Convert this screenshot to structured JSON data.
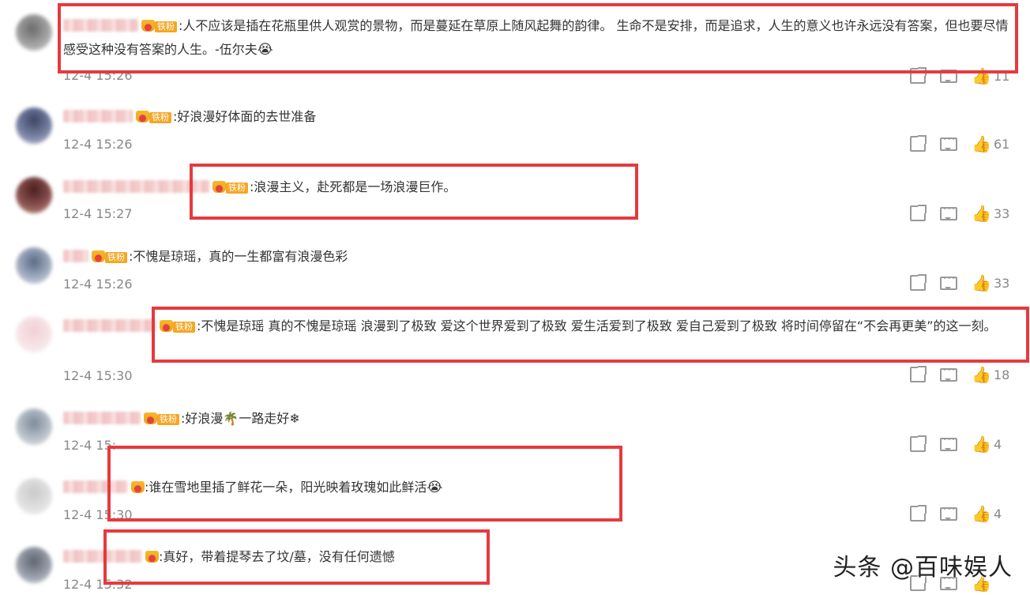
{
  "comments": [
    {
      "text": "人不应该是插在花瓶里供人观赏的景物，而是蔓延在草原上随风起舞的韵律。 生命不是安排，而是追求，人生的意义也许永远没有答案，但也要尽情感受这种没有答案的人生。-伍尔夫",
      "emoji": "😭",
      "badge": "铁粉",
      "time": "12-4 15:26",
      "likes": "11"
    },
    {
      "text": "好浪漫好体面的去世准备",
      "badge": "铁粉",
      "time": "12-4 15:26",
      "likes": "61"
    },
    {
      "text": "浪漫主义，赴死都是一场浪漫巨作。",
      "badge": "铁粉",
      "time": "12-4 15:27",
      "likes": "33"
    },
    {
      "text": "不愧是琼瑶，真的一生都富有浪漫色彩",
      "badge": "铁粉",
      "time": "12-4 15:26",
      "likes": "33"
    },
    {
      "text": "不愧是琼瑶 真的不愧是琼瑶 浪漫到了极致 爱这个世界爱到了极致 爱生活爱到了极致 爱自己爱到了极致 将时间停留在“不会再更美”的这一刻。",
      "badge": "铁粉",
      "time": "12-4 15:30",
      "likes": "18"
    },
    {
      "text": "好浪漫🌴一路走好❄",
      "badge": "铁粉",
      "time": "12-4 15:",
      "likes": "4"
    },
    {
      "text": "谁在雪地里插了鲜花一朵，阳光映着玫瑰如此鲜活",
      "emoji": "😭",
      "badge": "",
      "time": "12-4 15:30",
      "likes": "4"
    },
    {
      "text": "真好，带着提琴去了坟/墓，没有任何遗憾",
      "badge": "",
      "time": "12-4 15:32",
      "likes": ""
    }
  ],
  "watermark": "头条 @百味娱人",
  "colors": {
    "highlight": "#e63a3e",
    "fan_badge": "#f5a623",
    "time": "#888888",
    "icon": "#999999"
  },
  "icons": [
    "share-icon",
    "comment-icon",
    "like-icon",
    "crown-icon"
  ]
}
